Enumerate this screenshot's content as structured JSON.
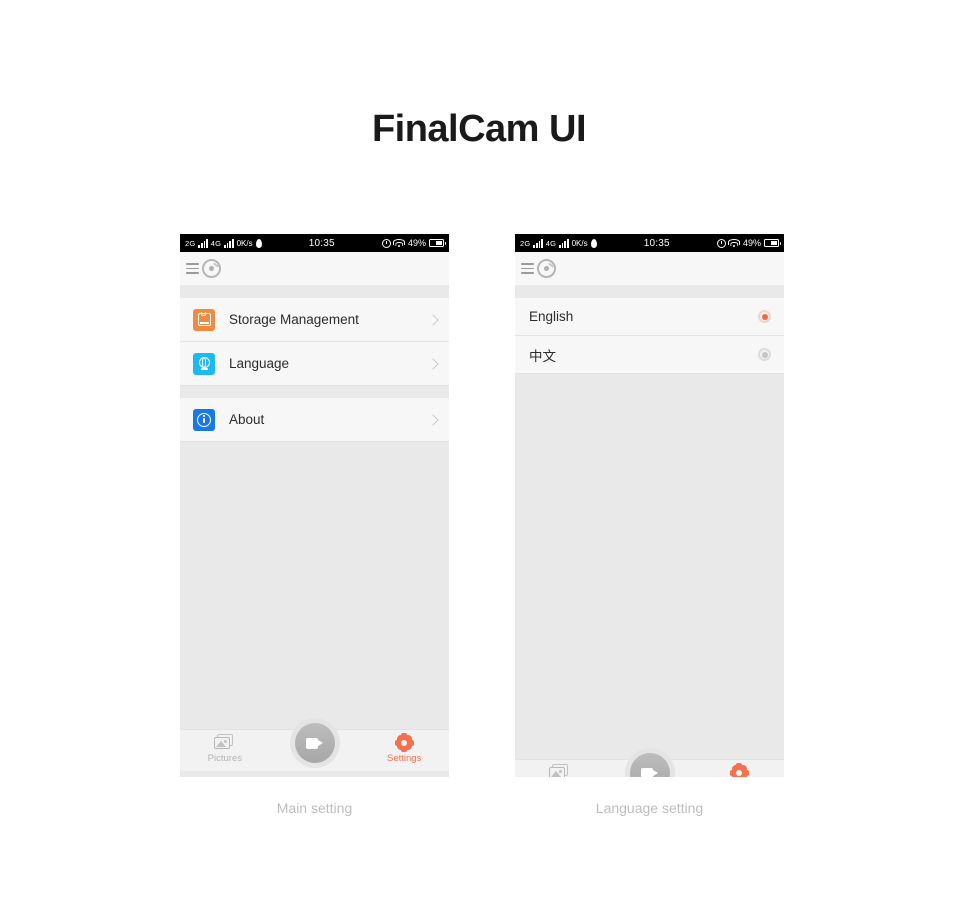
{
  "page": {
    "title": "FinalCam UI",
    "background_color": "#ffffff"
  },
  "colors": {
    "accent_orange": "#f4704f",
    "storage_icon_bg": "#f08a42",
    "language_icon_bg": "#1eb9f0",
    "about_icon_bg": "#1878e6",
    "screen_bg": "#e9e9e9",
    "list_bg": "#f7f7f7"
  },
  "status_bar": {
    "network_1": "2G",
    "network_2": "4G",
    "data_rate": "0K/s",
    "time": "10:35",
    "battery_percent": "49%",
    "alarm_icon": "alarm-clock-icon",
    "wifi_icon": "wifi-icon",
    "battery_icon": "battery-icon",
    "signal_icon": "signal-bars-icon",
    "droplet_icon": "droplet-icon"
  },
  "app_header": {
    "menu_icon": "hamburger-menu-icon",
    "logo_icon": "camera-gauge-logo-icon"
  },
  "phones": [
    {
      "id": "main-setting",
      "caption": "Main setting",
      "screen_type": "settings-list",
      "rows": [
        {
          "label": "Storage Management",
          "icon": "storage-icon",
          "icon_color": "#f08a42",
          "accessory": "chevron-right-icon"
        },
        {
          "label": "Language",
          "icon": "globe-icon",
          "icon_color": "#1eb9f0",
          "accessory": "chevron-right-icon"
        },
        {
          "label": "About",
          "icon": "info-icon",
          "icon_color": "#1878e6",
          "accessory": "chevron-right-icon"
        }
      ]
    },
    {
      "id": "language-setting",
      "caption": "Language setting",
      "screen_type": "language-list",
      "options": [
        {
          "label": "English",
          "selected": true
        },
        {
          "label": "中文",
          "selected": false
        }
      ]
    }
  ],
  "tabbar": {
    "pictures_label": "Pictures",
    "pictures_icon": "pictures-icon",
    "record_icon": "video-camera-icon",
    "settings_label": "Settings",
    "settings_icon": "gear-icon"
  }
}
